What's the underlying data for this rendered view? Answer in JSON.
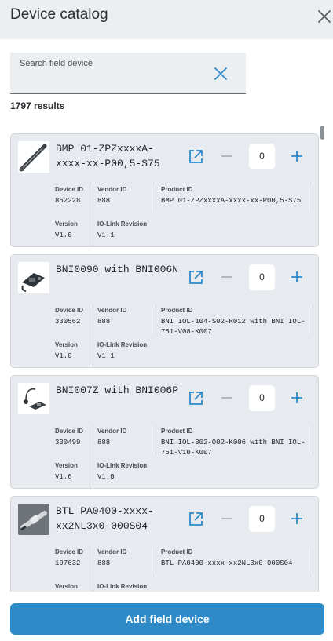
{
  "header": {
    "title": "Device catalog"
  },
  "search": {
    "placeholder": "Search field device"
  },
  "results": {
    "count_label": "1797 results"
  },
  "labels": {
    "device_id": "Device ID",
    "vendor_id": "Vendor ID",
    "product_id": "Product ID",
    "version": "Version",
    "io_link_revision": "IO-Link Revision"
  },
  "devices": [
    {
      "name": "BMP 01-ZPZxxxxA-xxxx-xx-P00,5-S75",
      "device_id": "852228",
      "vendor_id": "888",
      "product_id": "BMP 01-ZPZxxxxA-xxxx-xx-P00,5-S75",
      "version": "V1.0",
      "io_link_revision": "V1.1",
      "quantity": "0",
      "thumb_icon": "sensor-rod-icon"
    },
    {
      "name": "BNI0090 with BNI006N",
      "device_id": "330562",
      "vendor_id": "888",
      "product_id": "BNI IOL-104-S02-R012 with BNI IOL-751-V08-K007",
      "version": "V1.0",
      "io_link_revision": "V1.1",
      "quantity": "0",
      "thumb_icon": "io-module-icon"
    },
    {
      "name": "BNI007Z with BNI006P",
      "device_id": "330499",
      "vendor_id": "888",
      "product_id": "BNI IOL-302-002-K006 with BNI IOL-751-V10-K007",
      "version": "V1.6",
      "io_link_revision": "V1.0",
      "quantity": "0",
      "thumb_icon": "cable-module-icon"
    },
    {
      "name": "BTL PA0400-xxxx-xx2NL3x0-000S04",
      "device_id": "197632",
      "vendor_id": "888",
      "product_id": "BTL PA0400-xxxx-xx2NL3x0-000S04",
      "version": "",
      "io_link_revision": "",
      "quantity": "0",
      "thumb_icon": "transducer-icon"
    }
  ],
  "footer": {
    "add_label": "Add field device"
  },
  "colors": {
    "accent": "#2e8bc8",
    "header_bg": "#eceff2",
    "card_bg": "#e7eaee"
  }
}
